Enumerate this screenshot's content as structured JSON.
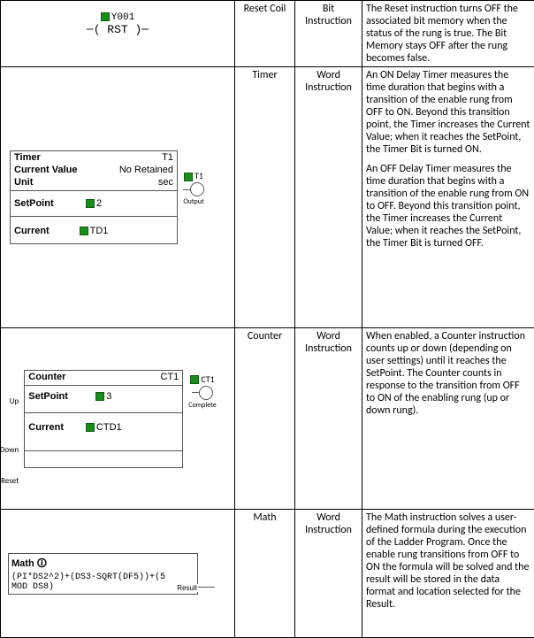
{
  "rows": {
    "reset": {
      "name": "Reset Coil",
      "type": "Bit Instruction",
      "desc": "The Reset instruction turns OFF the associated bit memory when the status of the rung is true. The Bit Memory stays OFF after the rung becomes false.",
      "diagram": {
        "tag": "Y001",
        "coil_text": "RST"
      }
    },
    "timer": {
      "name": "Timer",
      "type": "Word Instruction",
      "desc1": "An ON Delay Timer measures the time duration that begins with a transition of the enable rung from OFF to ON. Beyond this transition point, the Timer increases the Current Value; when it reaches the SetPoint, the Timer Bit is turned ON.",
      "desc2": "An OFF Delay Timer measures the time duration that begins with a transition of the enable rung from ON to OFF. Beyond this transition point, the Timer increases the Current Value; when it reaches the SetPoint, the Timer Bit is turned OFF.",
      "diagram": {
        "title": "Timer",
        "id": "T1",
        "row2l": "Current Value",
        "row2r": "No Retained",
        "row3l": "Unit",
        "row3r": "sec",
        "sp_label": "SetPoint",
        "sp_value": "2",
        "cur_label": "Current",
        "cur_value": "TD1",
        "out_label": "T1",
        "out_sub": "Output"
      }
    },
    "counter": {
      "name": "Counter",
      "type": "Word Instruction",
      "desc": "When enabled, a Counter instruction counts up or down (depending on user settings) until it reaches the SetPoint. The Counter counts in response to the transition from OFF to ON of the enabling rung (up or down rung).",
      "diagram": {
        "title": "Counter",
        "id": "CT1",
        "sp_label": "SetPoint",
        "sp_value": "3",
        "cur_label": "Current",
        "cur_value": "CTD1",
        "out_label": "CT1",
        "out_sub": "Complete",
        "rung_up": "Up",
        "rung_down": "Down",
        "rung_reset": "Reset"
      }
    },
    "math": {
      "name": "Math",
      "type": "Word Instruction",
      "desc": "The Math instruction solves a user-defined formula during the execution of the Ladder Program. Once the enable rung transitions from OFF to ON the formula will be solved and the result will be stored in the data format and location selected for the Result.",
      "diagram": {
        "title": "Math 🛈",
        "expr1": "(PI*DS2^2)+(DS3-SQRT(DF5))+(5",
        "expr2": " MOD DS8)",
        "out_label": "Result"
      }
    }
  }
}
